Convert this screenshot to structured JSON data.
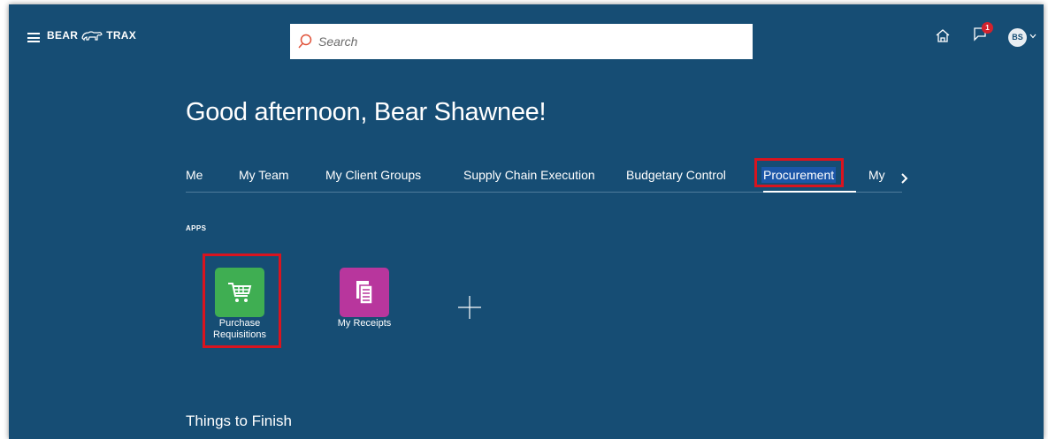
{
  "header": {
    "brand_left": "BEAR",
    "brand_right": "TRAX",
    "search_placeholder": "Search",
    "notification_count": "1",
    "avatar_initials": "BS"
  },
  "greeting": "Good afternoon, Bear Shawnee!",
  "tabs": [
    {
      "label": "Me"
    },
    {
      "label": "My Team"
    },
    {
      "label": "My Client Groups"
    },
    {
      "label": "Supply Chain Execution"
    },
    {
      "label": "Budgetary Control"
    },
    {
      "label": "Procurement",
      "active": true
    },
    {
      "label": "My"
    }
  ],
  "apps": {
    "section_label": "APPS",
    "items": [
      {
        "label_line1": "Purchase",
        "label_line2": "Requisitions",
        "icon": "shopping-cart-icon",
        "color": "#3fae52"
      },
      {
        "label": "My Receipts",
        "icon": "receipt-document-icon",
        "color": "#b8369d"
      }
    ]
  },
  "things_to_finish": "Things to Finish",
  "colors": {
    "background": "#164d74",
    "highlight": "#d9141f"
  }
}
